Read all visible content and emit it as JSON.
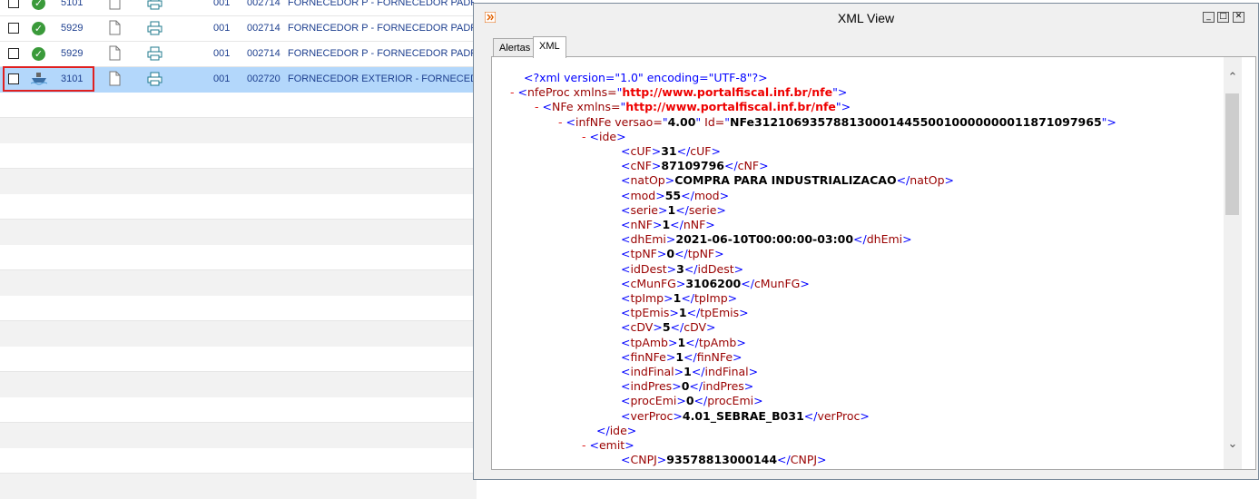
{
  "grid": {
    "rows": [
      {
        "num": "5101",
        "c1": "001",
        "c2": "002714",
        "desc": "FORNECEDOR P - FORNECEDOR PADRÃO",
        "status": "ok"
      },
      {
        "num": "5929",
        "c1": "001",
        "c2": "002714",
        "desc": "FORNECEDOR P - FORNECEDOR PADRÃO",
        "status": "ok"
      },
      {
        "num": "5929",
        "c1": "001",
        "c2": "002714",
        "desc": "FORNECEDOR P - FORNECEDOR PADRÃO",
        "status": "ok"
      },
      {
        "num": "3101",
        "c1": "001",
        "c2": "002720",
        "desc": "FORNECEDOR EXTERIOR - FORNECEDOR",
        "status": "ship"
      }
    ]
  },
  "window": {
    "title": "XML View",
    "tabs": [
      "Alertas",
      "XML"
    ],
    "active_tab": "XML",
    "buttons": {
      "minimize": "_",
      "maximize": "□",
      "close": "✕"
    }
  },
  "xml": {
    "pi": "<?xml version=\"1.0\" encoding=\"UTF-8\"?>",
    "ns_url": "http://www.portalfiscal.inf.br/nfe",
    "infnfe_versao": "4.00",
    "infnfe_id": "NFe31210693578813000144550010000000011871097965",
    "ide": [
      {
        "tag": "cUF",
        "value": "31"
      },
      {
        "tag": "cNF",
        "value": "87109796"
      },
      {
        "tag": "natOp",
        "value": "COMPRA PARA INDUSTRIALIZACAO"
      },
      {
        "tag": "mod",
        "value": "55"
      },
      {
        "tag": "serie",
        "value": "1"
      },
      {
        "tag": "nNF",
        "value": "1"
      },
      {
        "tag": "dhEmi",
        "value": "2021-06-10T00:00:00-03:00"
      },
      {
        "tag": "tpNF",
        "value": "0"
      },
      {
        "tag": "idDest",
        "value": "3"
      },
      {
        "tag": "cMunFG",
        "value": "3106200"
      },
      {
        "tag": "tpImp",
        "value": "1"
      },
      {
        "tag": "tpEmis",
        "value": "1"
      },
      {
        "tag": "cDV",
        "value": "5"
      },
      {
        "tag": "tpAmb",
        "value": "1"
      },
      {
        "tag": "finNFe",
        "value": "1"
      },
      {
        "tag": "indFinal",
        "value": "1"
      },
      {
        "tag": "indPres",
        "value": "0"
      },
      {
        "tag": "procEmi",
        "value": "0"
      },
      {
        "tag": "verProc",
        "value": "4.01_SEBRAE_B031"
      }
    ],
    "emit_cnpj": "93578813000144"
  }
}
